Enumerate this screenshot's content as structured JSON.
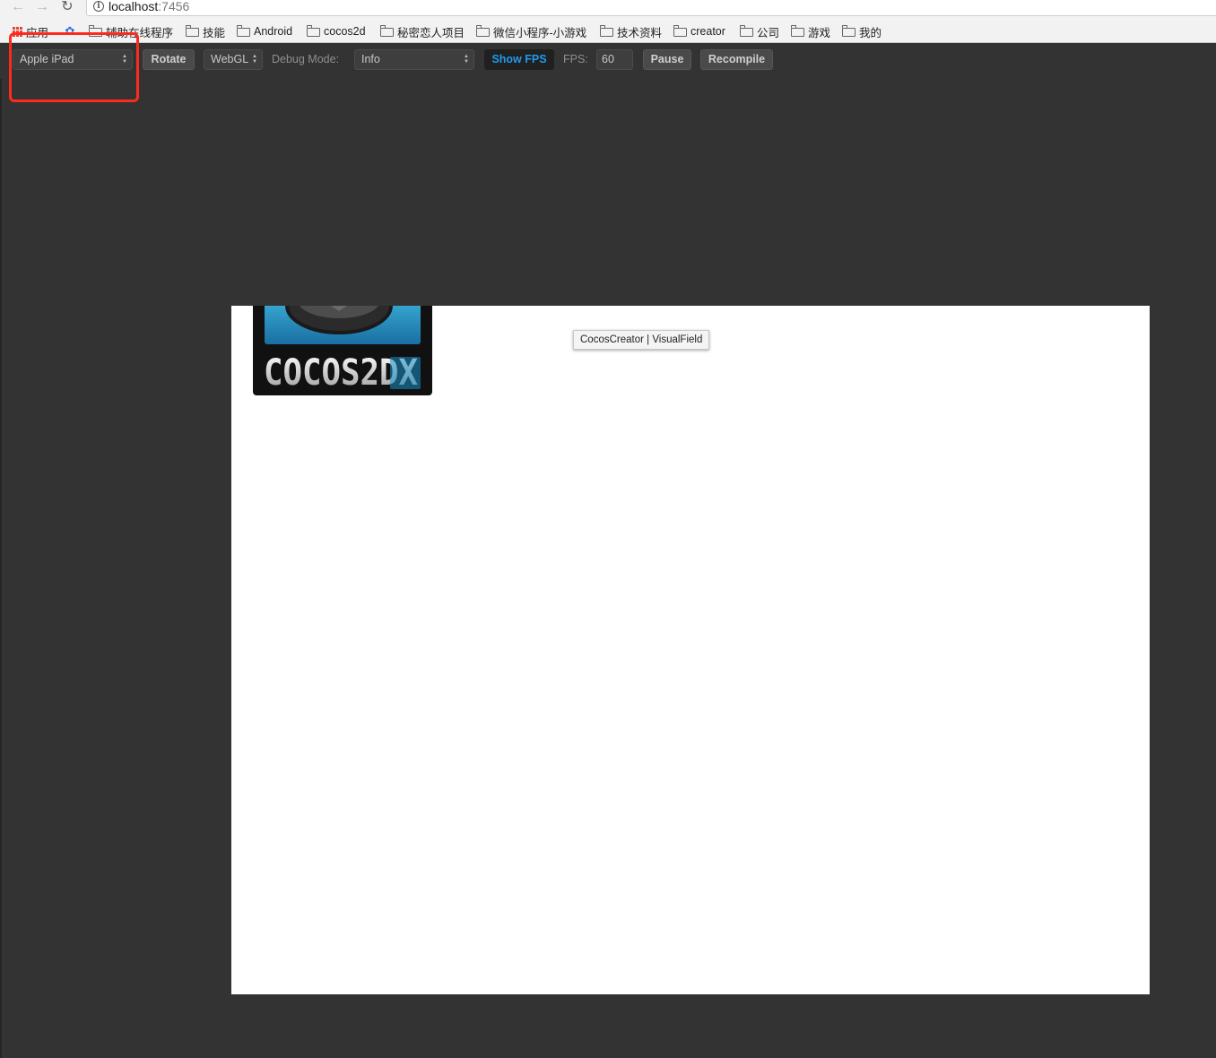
{
  "browser": {
    "url_host": "localhost",
    "url_port": ":7456"
  },
  "bookmarks": {
    "apps_label": "应用",
    "items": [
      {
        "label": "辅助在线程序",
        "icon": "paw-icon"
      },
      {
        "label": "技能",
        "icon": "folder-icon"
      },
      {
        "label": "Android",
        "icon": "folder-icon"
      },
      {
        "label": "cocos2d",
        "icon": "folder-icon"
      },
      {
        "label": "秘密恋人项目",
        "icon": "folder-icon"
      },
      {
        "label": "微信小程序-小游戏",
        "icon": "folder-icon"
      },
      {
        "label": "技术资料",
        "icon": "folder-icon"
      },
      {
        "label": "creator",
        "icon": "folder-icon"
      },
      {
        "label": "公司",
        "icon": "folder-icon"
      },
      {
        "label": "游戏",
        "icon": "folder-icon"
      },
      {
        "label": "我的",
        "icon": "folder-icon"
      }
    ]
  },
  "toolbar": {
    "device_select": "Apple iPad",
    "rotate_label": "Rotate",
    "render_mode": "WebGL",
    "debug_mode_label": "Debug Mode:",
    "debug_mode_value": "Info",
    "show_fps_label": "Show FPS",
    "fps_label": "FPS:",
    "fps_value": "60",
    "pause_label": "Pause",
    "recompile_label": "Recompile"
  },
  "canvas": {
    "logo_text": "COCOS2DX",
    "tooltip": "CocosCreator | VisualField"
  },
  "colors": {
    "background": "#333333",
    "canvas": "#ffffff",
    "accent_blue": "#1e9bef",
    "highlight_red": "#ff2a1f"
  }
}
